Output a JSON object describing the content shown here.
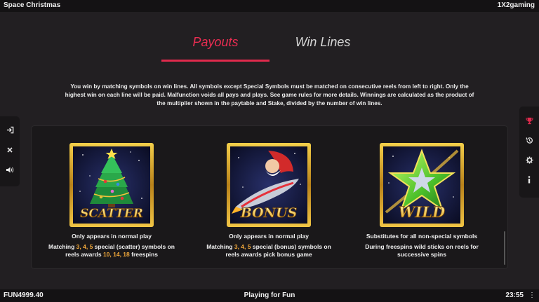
{
  "topbar": {
    "title": "Space Christmas",
    "brand": "1X2gaming"
  },
  "tabs": [
    {
      "label": "Payouts",
      "active": true
    },
    {
      "label": "Win Lines",
      "active": false
    }
  ],
  "description": "You win by matching symbols on win lines. All symbols except Special Symbols must be matched on consecutive reels from left to right. Only the highest win on each line will be paid. Malfunction voids all pays and plays. See game rules for more details. Winnings are calculated as the product of the multiplier shown in the paytable and Stake, divided by the number of win lines.",
  "left_sidebar": [
    {
      "icon": "exit-icon"
    },
    {
      "icon": "close-icon"
    },
    {
      "icon": "sound-icon"
    }
  ],
  "right_sidebar": [
    {
      "icon": "trophy-icon"
    },
    {
      "icon": "history-icon"
    },
    {
      "icon": "settings-gear-icon"
    },
    {
      "icon": "info-icon"
    }
  ],
  "symbols": [
    {
      "word": "SCATTER",
      "icon": "christmas-tree-scatter-icon",
      "headline": "Only appears in normal play",
      "line1_pre": "Matching ",
      "line1_counts": "3, 4, 5",
      "line1_post": " special (scatter) symbols on",
      "line2_pre": "reels awards ",
      "line2_values": "10, 14, 18",
      "line2_post": " freespins"
    },
    {
      "word": "BONUS",
      "icon": "santa-spaceship-bonus-icon",
      "headline": "Only appears in normal play",
      "line1_pre": "Matching ",
      "line1_counts": "3, 4, 5",
      "line1_post": " special (bonus) symbols on",
      "line2_text": "reels awards pick bonus game"
    },
    {
      "word": "WILD",
      "icon": "star-wild-icon",
      "headline": "Substitutes for all non-special symbols",
      "line1_text": "During freespins wild sticks on reels for",
      "line2_text": "successive spins"
    }
  ],
  "bottombar": {
    "balance": "FUN4999.40",
    "mode": "Playing for Fun",
    "clock": "23:55",
    "menu": "⋮"
  },
  "colors": {
    "accent": "#e02a4d",
    "highlight": "#f2a93b",
    "gold_frame": "#d8a628"
  }
}
